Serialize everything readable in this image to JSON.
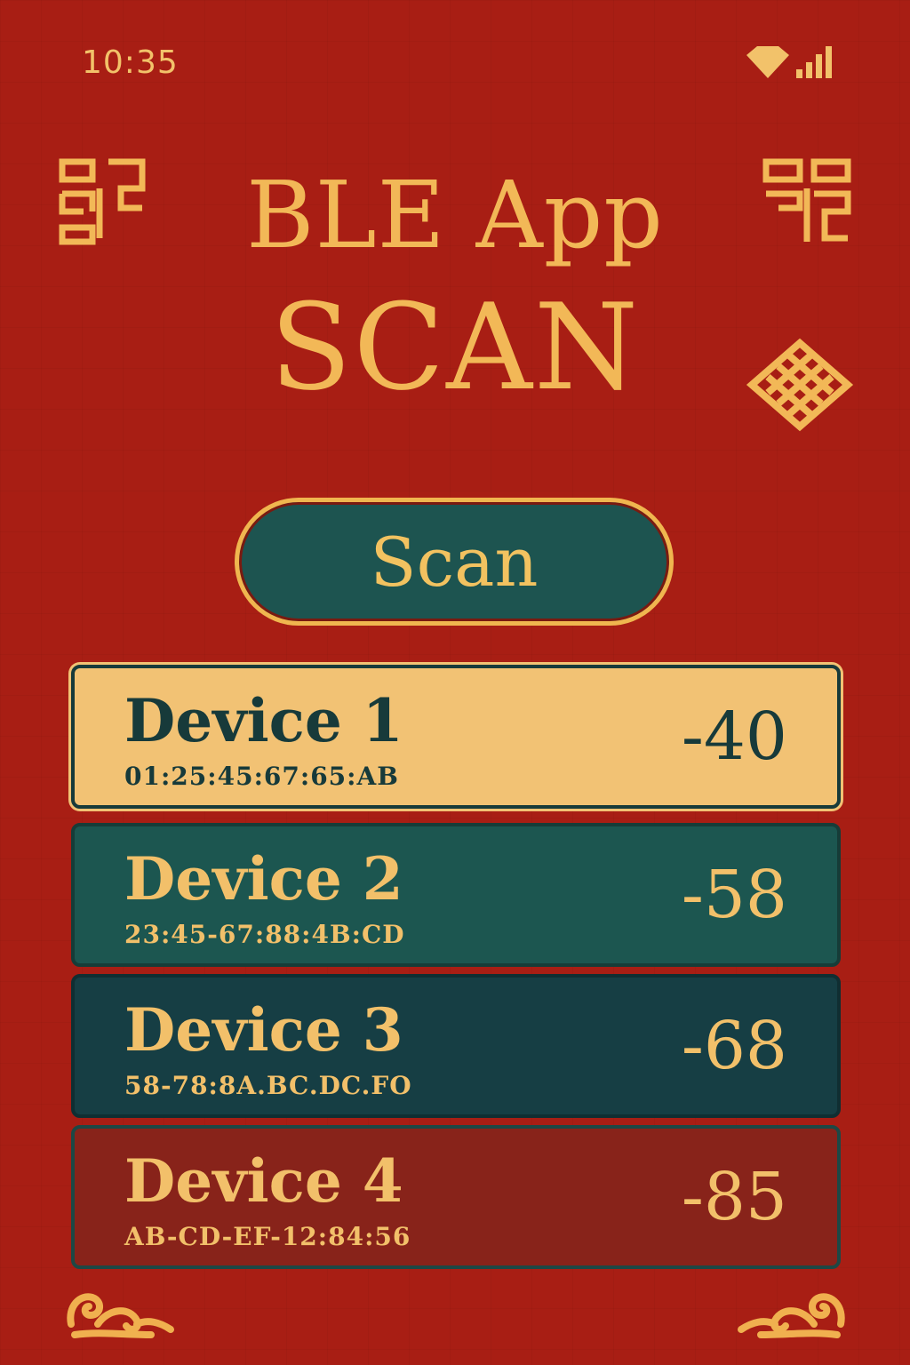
{
  "status_bar": {
    "time": "10:35",
    "icons": [
      "wifi-icon",
      "signal-icon"
    ]
  },
  "title": {
    "line1": "BLE App",
    "line2": "SCAN"
  },
  "scan_button": {
    "label": "Scan"
  },
  "devices": [
    {
      "name": "Device 1",
      "mac": "01:25:45:67:65:AB",
      "rssi": "-40",
      "selected": true
    },
    {
      "name": "Device 2",
      "mac": "23:45-67:88:4B:CD",
      "rssi": "-58"
    },
    {
      "name": "Device 3",
      "mac": "58-78:8A.BC.DC.FO",
      "rssi": "-68"
    },
    {
      "name": "Device 4",
      "mac": "AB-CD-EF-12:84:56",
      "rssi": "-85"
    }
  ],
  "colors": {
    "background": "#a81e14",
    "gold": "#f2b857",
    "teal": "#1d5450",
    "dark_teal": "#163e44",
    "cream": "#f2c274",
    "maroon": "#88231a"
  }
}
